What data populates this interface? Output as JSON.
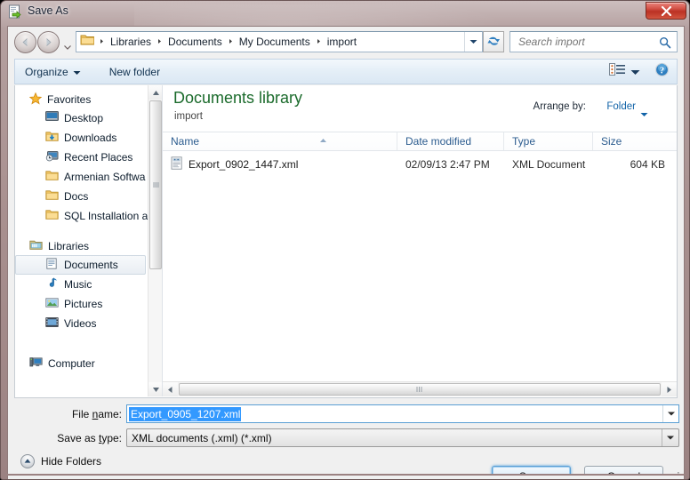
{
  "window": {
    "title": "Save As",
    "title_icon": "save-as-document-icon",
    "close_label": "x",
    "frame_color": "#a8908f",
    "border_color": "#6b5656"
  },
  "navbar": {
    "back_icon": "arrow-left-icon",
    "forward_icon": "arrow-right-icon",
    "recent_pages_icon": "chevron-down-icon",
    "folder_icon": "folder-icon",
    "breadcrumbs": [
      "Libraries",
      "Documents",
      "My Documents",
      "import"
    ],
    "address_dropdown_icon": "chevron-down-icon",
    "refresh_icon": "refresh-icon",
    "search": {
      "placeholder": "Search import",
      "value": "",
      "icon": "search-icon"
    }
  },
  "toolbar": {
    "organize_label": "Organize",
    "organize_caret_icon": "caret-down-icon",
    "new_folder_label": "New folder",
    "view_icon": "change-view-icon",
    "view_caret_icon": "caret-down-icon",
    "help_icon": "help-icon"
  },
  "sidebar": {
    "groups": [
      {
        "label": "Favorites",
        "icon": "star-icon",
        "items": [
          {
            "label": "Desktop",
            "icon": "desktop-icon",
            "selected": false
          },
          {
            "label": "Downloads",
            "icon": "downloads-folder-icon",
            "selected": false
          },
          {
            "label": "Recent Places",
            "icon": "recent-places-icon",
            "selected": false
          },
          {
            "label": "Armenian Softwa",
            "icon": "folder-icon",
            "selected": false
          },
          {
            "label": "Docs",
            "icon": "folder-icon",
            "selected": false
          },
          {
            "label": "SQL Installation a",
            "icon": "folder-icon",
            "selected": false
          }
        ]
      },
      {
        "label": "Libraries",
        "icon": "libraries-icon",
        "items": [
          {
            "label": "Documents",
            "icon": "documents-library-icon",
            "selected": true
          },
          {
            "label": "Music",
            "icon": "music-library-icon",
            "selected": false
          },
          {
            "label": "Pictures",
            "icon": "pictures-library-icon",
            "selected": false
          },
          {
            "label": "Videos",
            "icon": "videos-library-icon",
            "selected": false
          }
        ]
      },
      {
        "label": "Computer",
        "icon": "computer-icon",
        "items": []
      }
    ],
    "scroll_up_icon": "scroll-up-arrow-icon",
    "scroll_down_icon": "scroll-down-arrow-icon"
  },
  "main": {
    "library_title": "Documents library",
    "library_subtitle": "import",
    "arrange_by_label": "Arrange by:",
    "arrange_by_value": "Folder",
    "arrange_caret_icon": "caret-down-icon",
    "columns": [
      {
        "label": "Name",
        "sorted": "ascending"
      },
      {
        "label": "Date modified",
        "sorted": ""
      },
      {
        "label": "Type",
        "sorted": ""
      },
      {
        "label": "Size",
        "sorted": ""
      }
    ],
    "sort_indicator_icon": "sort-ascending-icon",
    "files": [
      {
        "name": "Export_0902_1447.xml",
        "icon": "xml-document-icon",
        "date_modified": "02/09/13 2:47 PM",
        "type": "XML Document",
        "size": "604 KB"
      }
    ],
    "hscroll": {
      "left_arrow_icon": "scroll-left-arrow-icon",
      "right_arrow_icon": "scroll-right-arrow-icon",
      "grip_icon": "scrollbar-grip-icon"
    }
  },
  "form": {
    "filename_label_pre": "File ",
    "filename_label_key": "n",
    "filename_label_post": "ame:",
    "filename_value": "Export_0905_1207.xml",
    "filename_selected": true,
    "filename_dropdown_icon": "chevron-down-icon",
    "savetype_label_pre": "Save as ",
    "savetype_label_key": "t",
    "savetype_label_post": "ype:",
    "savetype_value": "XML documents (.xml) (*.xml)",
    "savetype_dropdown_icon": "chevron-down-icon",
    "savetype_options": [
      "XML documents (.xml) (*.xml)"
    ]
  },
  "footer": {
    "hide_folders_label": "Hide Folders",
    "hide_folders_icon": "collapse-up-icon",
    "save_label": "Save",
    "cancel_label": "Cancel",
    "save_is_default": true,
    "resize_grip_icon": "resize-grip-icon"
  },
  "colors": {
    "library_title_green": "#1b6b2c",
    "link_blue": "#1163a8",
    "selection_blue": "#3399ff",
    "column_header_blue": "#2c5c8f",
    "close_red": "#bb3124"
  }
}
